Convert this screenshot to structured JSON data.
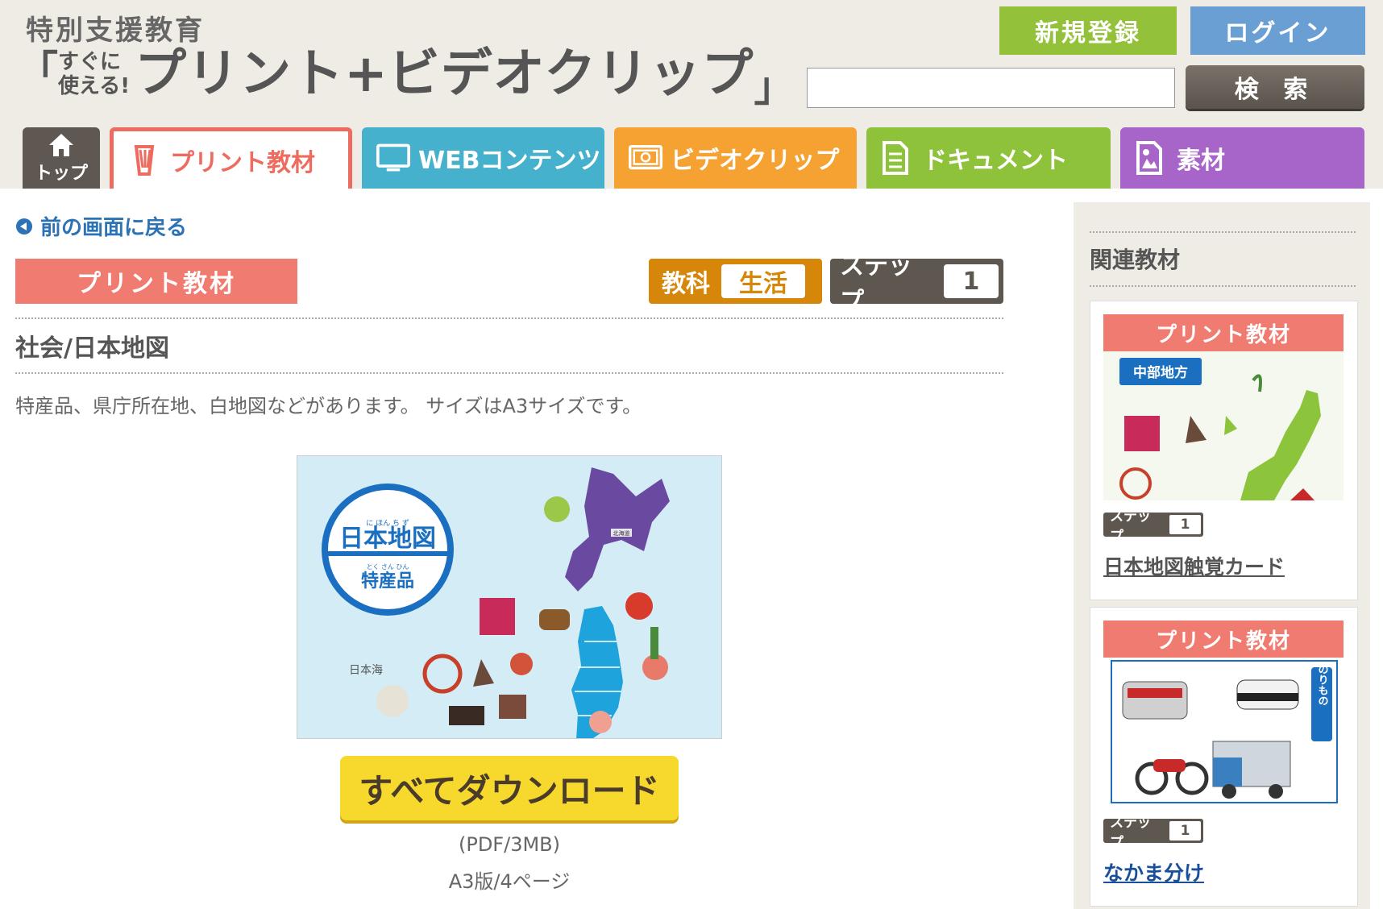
{
  "header": {
    "subtitle": "特別支援教育",
    "title_open": "「",
    "title_small_line1": "すぐに",
    "title_small_line2": "使える!",
    "title_main": "プリント+ビデオクリップ",
    "title_close": "」",
    "register_label": "新規登録",
    "login_label": "ログイン",
    "search_value": "",
    "search_label": "検 索"
  },
  "nav": {
    "home": "トップ",
    "print": "プリント教材",
    "web": "WEBコンテンツ",
    "video": "ビデオクリップ",
    "document": "ドキュメント",
    "material": "素材"
  },
  "main": {
    "back_label": "前の画面に戻る",
    "category": "プリント教材",
    "subject_label": "教科",
    "subject_value": "生活",
    "step_label": "ステップ",
    "step_value": "1",
    "title": "社会/日本地図",
    "description": "特産品、県庁所在地、白地図などがあります。 サイズはA3サイズです。",
    "preview": {
      "title": "日本地図",
      "subtitle": "特産品",
      "furigana_title": "に ほん ち ず",
      "furigana_subtitle": "とく さん ひん",
      "sea_label": "日本海",
      "hokkaido_label": "北海道"
    },
    "download_label": "すべてダウンロード",
    "file_format": "(PDF/3MB)",
    "file_pages": "A3版/4ページ"
  },
  "sidebar": {
    "title": "関連教材",
    "cards": [
      {
        "category": "プリント教材",
        "thumb_label": "中部地方",
        "step_label": "ステップ",
        "step_value": "1",
        "link": "日本地図触覚カード"
      },
      {
        "category": "プリント教材",
        "thumb_label": "のりもの",
        "step_label": "ステップ",
        "step_value": "1",
        "link": "なかま分け"
      }
    ]
  },
  "colors": {
    "print_accent": "#ee6b5f",
    "web_accent": "#46b1cd",
    "video_accent": "#f5a233",
    "doc_accent": "#8fc23b",
    "material_accent": "#a865c9",
    "link_blue": "#2c72b6",
    "download_yellow": "#f6d92c"
  },
  "icons": {
    "home": "house-icon",
    "print": "pencil-icon",
    "web": "monitor-icon",
    "video": "video-icon",
    "document": "document-icon",
    "material": "image-icon",
    "back": "circle-arrow-left-icon"
  }
}
